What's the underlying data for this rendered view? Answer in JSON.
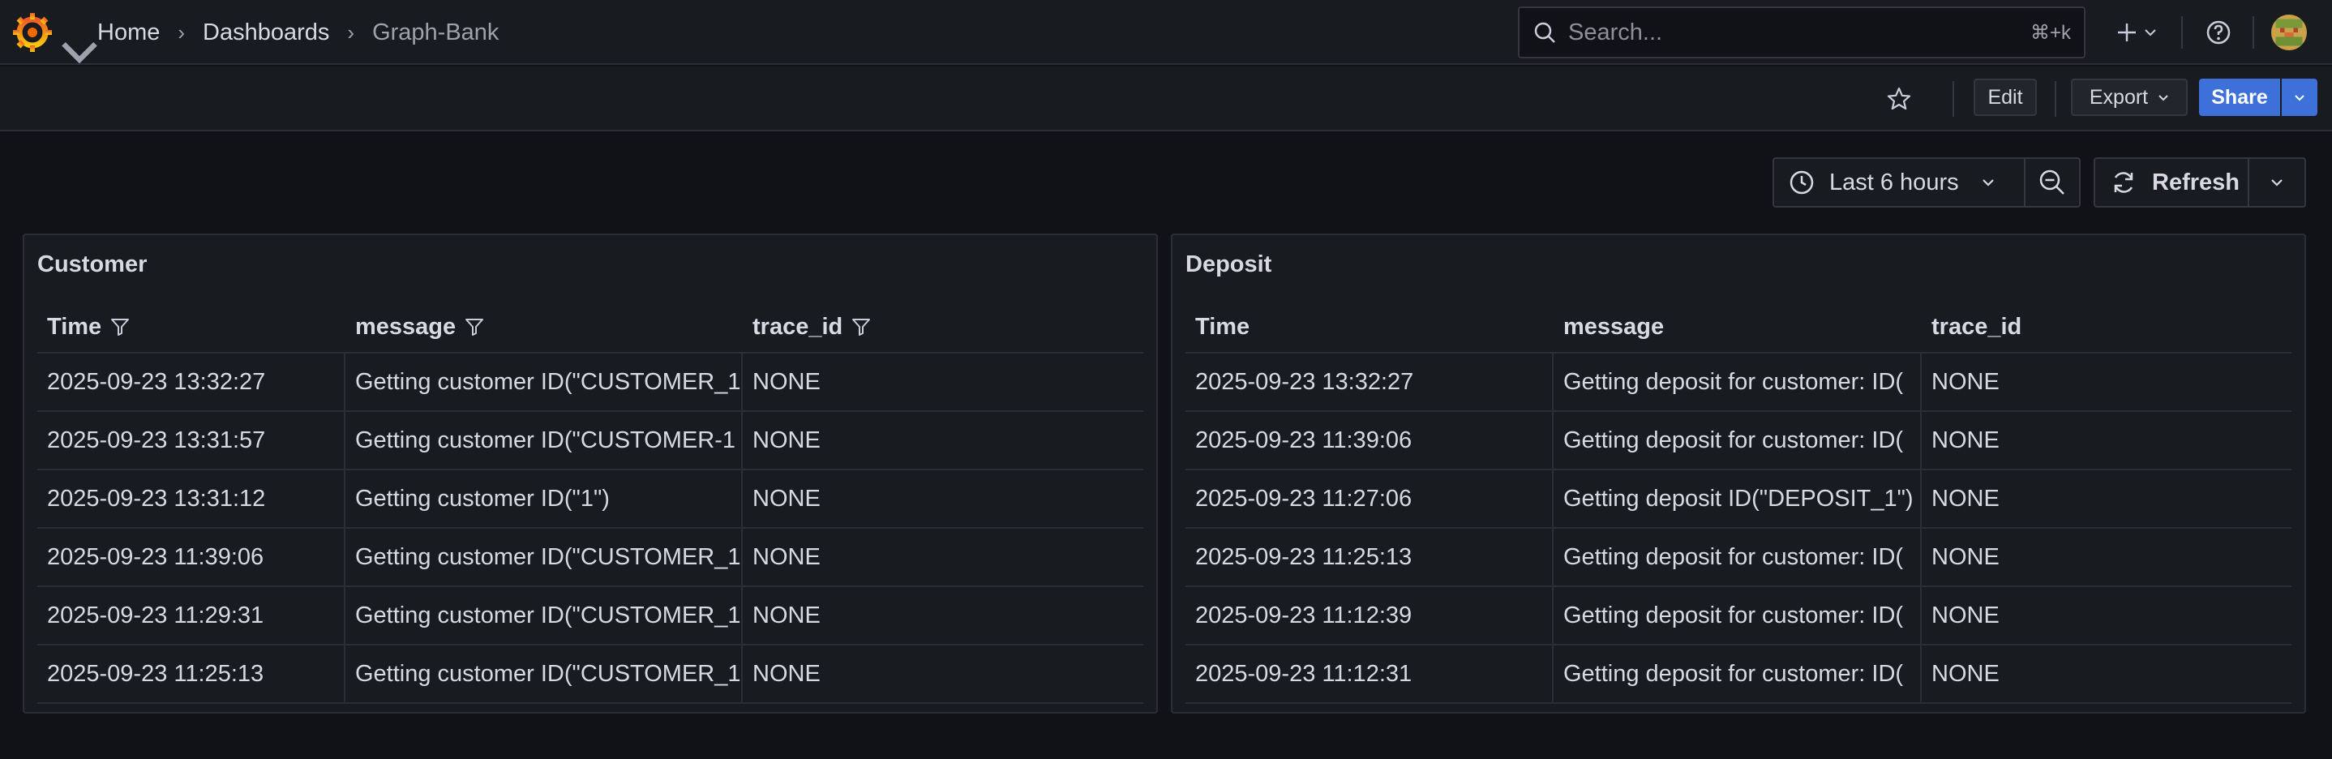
{
  "breadcrumb": [
    "Home",
    "Dashboards",
    "Graph-Bank"
  ],
  "search": {
    "placeholder": "Search...",
    "shortcut": "⌘+k"
  },
  "toolbar": {
    "edit": "Edit",
    "export": "Export",
    "share": "Share"
  },
  "controls": {
    "time_range": "Last 6 hours",
    "refresh": "Refresh"
  },
  "colors": {
    "primary": "#3d71d9",
    "background": "#111217",
    "panel": "#181b1f"
  },
  "panels": [
    {
      "title": "Customer",
      "columns": [
        "Time",
        "message",
        "trace_id"
      ],
      "rows": [
        [
          "2025-09-23 13:32:27",
          "Getting customer ID(\"CUSTOMER_1",
          "NONE"
        ],
        [
          "2025-09-23 13:31:57",
          "Getting customer ID(\"CUSTOMER-1",
          "NONE"
        ],
        [
          "2025-09-23 13:31:12",
          "Getting customer ID(\"1\")",
          "NONE"
        ],
        [
          "2025-09-23 11:39:06",
          "Getting customer ID(\"CUSTOMER_1",
          "NONE"
        ],
        [
          "2025-09-23 11:29:31",
          "Getting customer ID(\"CUSTOMER_1",
          "NONE"
        ],
        [
          "2025-09-23 11:25:13",
          "Getting customer ID(\"CUSTOMER_1",
          "NONE"
        ]
      ]
    },
    {
      "title": "Deposit",
      "columns": [
        "Time",
        "message",
        "trace_id"
      ],
      "rows": [
        [
          "2025-09-23 13:32:27",
          "Getting deposit for customer: ID(",
          "NONE"
        ],
        [
          "2025-09-23 11:39:06",
          "Getting deposit for customer: ID(",
          "NONE"
        ],
        [
          "2025-09-23 11:27:06",
          "Getting deposit ID(\"DEPOSIT_1\")",
          "NONE"
        ],
        [
          "2025-09-23 11:25:13",
          "Getting deposit for customer: ID(",
          "NONE"
        ],
        [
          "2025-09-23 11:12:39",
          "Getting deposit for customer: ID(",
          "NONE"
        ],
        [
          "2025-09-23 11:12:31",
          "Getting deposit for customer: ID(",
          "NONE"
        ]
      ]
    }
  ]
}
